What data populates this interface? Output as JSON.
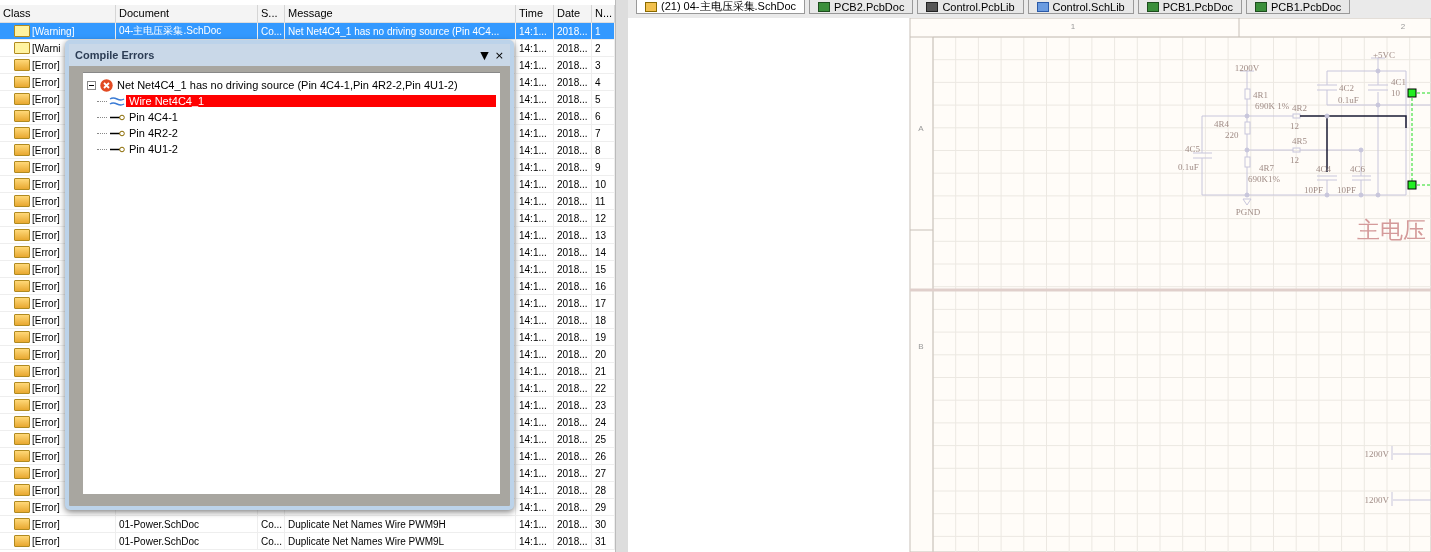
{
  "messages": {
    "columns": [
      "Class",
      "Document",
      "S...",
      "Message",
      "Time",
      "Date",
      "N..."
    ],
    "rows": [
      {
        "kind": "warning",
        "selected": true,
        "class": "[Warning]",
        "document": "04-主电压采集.SchDoc",
        "source": "Co...",
        "message": "Net Net4C4_1 has no driving source (Pin 4C4...",
        "time": "14:1...",
        "date": "2018...",
        "n": "1"
      },
      {
        "kind": "warning",
        "selected": false,
        "class": "[Warni",
        "time": "14:1...",
        "date": "2018...",
        "n": "2"
      },
      {
        "kind": "error",
        "selected": false,
        "class": "[Error]",
        "time": "14:1...",
        "date": "2018...",
        "n": "3"
      },
      {
        "kind": "error",
        "selected": false,
        "class": "[Error]",
        "time": "14:1...",
        "date": "2018...",
        "n": "4"
      },
      {
        "kind": "error",
        "selected": false,
        "class": "[Error]",
        "time": "14:1...",
        "date": "2018...",
        "n": "5"
      },
      {
        "kind": "error",
        "selected": false,
        "class": "[Error]",
        "time": "14:1...",
        "date": "2018...",
        "n": "6"
      },
      {
        "kind": "error",
        "selected": false,
        "class": "[Error]",
        "time": "14:1...",
        "date": "2018...",
        "n": "7"
      },
      {
        "kind": "error",
        "selected": false,
        "class": "[Error]",
        "time": "14:1...",
        "date": "2018...",
        "n": "8"
      },
      {
        "kind": "error",
        "selected": false,
        "class": "[Error]",
        "time": "14:1...",
        "date": "2018...",
        "n": "9"
      },
      {
        "kind": "error",
        "selected": false,
        "class": "[Error]",
        "time": "14:1...",
        "date": "2018...",
        "n": "10"
      },
      {
        "kind": "error",
        "selected": false,
        "class": "[Error]",
        "time": "14:1...",
        "date": "2018...",
        "n": "11"
      },
      {
        "kind": "error",
        "selected": false,
        "class": "[Error]",
        "time": "14:1...",
        "date": "2018...",
        "n": "12"
      },
      {
        "kind": "error",
        "selected": false,
        "class": "[Error]",
        "time": "14:1...",
        "date": "2018...",
        "n": "13"
      },
      {
        "kind": "error",
        "selected": false,
        "class": "[Error]",
        "time": "14:1...",
        "date": "2018...",
        "n": "14"
      },
      {
        "kind": "error",
        "selected": false,
        "class": "[Error]",
        "time": "14:1...",
        "date": "2018...",
        "n": "15"
      },
      {
        "kind": "error",
        "selected": false,
        "class": "[Error]",
        "time": "14:1...",
        "date": "2018...",
        "n": "16"
      },
      {
        "kind": "error",
        "selected": false,
        "class": "[Error]",
        "time": "14:1...",
        "date": "2018...",
        "n": "17"
      },
      {
        "kind": "error",
        "selected": false,
        "class": "[Error]",
        "time": "14:1...",
        "date": "2018...",
        "n": "18"
      },
      {
        "kind": "error",
        "selected": false,
        "class": "[Error]",
        "time": "14:1...",
        "date": "2018...",
        "n": "19"
      },
      {
        "kind": "error",
        "selected": false,
        "class": "[Error]",
        "time": "14:1...",
        "date": "2018...",
        "n": "20"
      },
      {
        "kind": "error",
        "selected": false,
        "class": "[Error]",
        "time": "14:1...",
        "date": "2018...",
        "n": "21"
      },
      {
        "kind": "error",
        "selected": false,
        "class": "[Error]",
        "time": "14:1...",
        "date": "2018...",
        "n": "22"
      },
      {
        "kind": "error",
        "selected": false,
        "class": "[Error]",
        "time": "14:1...",
        "date": "2018...",
        "n": "23"
      },
      {
        "kind": "error",
        "selected": false,
        "class": "[Error]",
        "time": "14:1...",
        "date": "2018...",
        "n": "24"
      },
      {
        "kind": "error",
        "selected": false,
        "class": "[Error]",
        "time": "14:1...",
        "date": "2018...",
        "n": "25"
      },
      {
        "kind": "error",
        "selected": false,
        "class": "[Error]",
        "time": "14:1...",
        "date": "2018...",
        "n": "26"
      },
      {
        "kind": "error",
        "selected": false,
        "class": "[Error]",
        "time": "14:1...",
        "date": "2018...",
        "n": "27"
      },
      {
        "kind": "error",
        "selected": false,
        "class": "[Error]",
        "time": "14:1...",
        "date": "2018...",
        "n": "28"
      },
      {
        "kind": "error",
        "selected": false,
        "class": "[Error]",
        "time": "14:1...",
        "date": "2018...",
        "n": "29"
      },
      {
        "kind": "error",
        "selected": false,
        "class": "[Error]",
        "document": "01-Power.SchDoc",
        "source": "Co...",
        "message": "Duplicate Net Names Wire PWM9H",
        "time": "14:1...",
        "date": "2018...",
        "n": "30"
      },
      {
        "kind": "error",
        "selected": false,
        "class": "[Error]",
        "document": "01-Power.SchDoc",
        "source": "Co...",
        "message": "Duplicate Net Names Wire PWM9L",
        "time": "14:1...",
        "date": "2018...",
        "n": "31"
      }
    ]
  },
  "compile_errors": {
    "title": "Compile Errors",
    "menu_glyph": "▼",
    "close_glyph": "×",
    "tree": {
      "label": "Net Net4C4_1 has no driving source (Pin 4C4-1,Pin 4R2-2,Pin 4U1-2)",
      "expanded": true,
      "children": [
        {
          "kind": "wire",
          "label": "Wire Net4C4_1",
          "selected": true
        },
        {
          "kind": "pin",
          "label": "Pin 4C4-1",
          "selected": false
        },
        {
          "kind": "pin",
          "label": "Pin 4R2-2",
          "selected": false
        },
        {
          "kind": "pin",
          "label": "Pin 4U1-2",
          "selected": false
        }
      ]
    }
  },
  "document_tabs": [
    {
      "kind": "schdoc",
      "label": "(21) 04-主电压采集.SchDoc",
      "selected": true
    },
    {
      "kind": "pcbdoc",
      "label": "PCB2.PcbDoc",
      "selected": false
    },
    {
      "kind": "pcblib",
      "label": "Control.PcbLib",
      "selected": false
    },
    {
      "kind": "schlib",
      "label": "Control.SchLib",
      "selected": false
    },
    {
      "kind": "pcbdoc",
      "label": "PCB1.PcbDoc",
      "selected": false
    },
    {
      "kind": "pcbdoc",
      "label": "PCB1.PcbDoc",
      "selected": false
    }
  ],
  "schematic": {
    "column_zones": [
      "1",
      "2"
    ],
    "row_zones": [
      "A",
      "B"
    ],
    "labels": [
      "1200V",
      "4R1",
      "690K 1%",
      "4R2",
      "12",
      "4R4",
      "220",
      "4R5",
      "12",
      "4C5",
      "0.1uF",
      "4R7",
      "690K1%",
      "4C4",
      "10PF",
      "4C6",
      "10PF",
      "PGND",
      "+5VC",
      "4C2",
      "0.1uF",
      "4C1",
      "10"
    ],
    "sheet_title": "主电压",
    "port_labels": [
      "1200V",
      "1200V"
    ]
  }
}
